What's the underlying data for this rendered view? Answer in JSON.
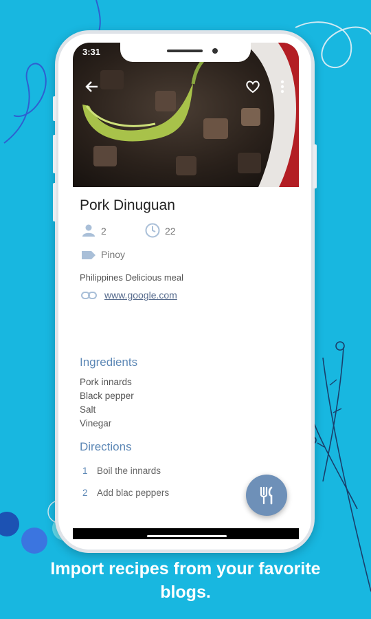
{
  "status_bar": {
    "time": "3:31"
  },
  "recipe": {
    "title": "Pork Dinuguan",
    "servings": "2",
    "time": "22",
    "category": "Pinoy",
    "description": "Philippines Delicious meal",
    "link": "www.google.com"
  },
  "ingredients": {
    "heading": "Ingredients",
    "items": [
      "Pork innards",
      "Black pepper",
      "Salt",
      "Vinegar"
    ]
  },
  "directions": {
    "heading": "Directions",
    "steps": [
      {
        "num": "1",
        "text": "Boil the innards"
      },
      {
        "num": "2",
        "text": "Add blac peppers"
      }
    ]
  },
  "icons": {
    "back": "arrow-left-icon",
    "favorite": "heart-outline-icon",
    "more": "more-vert-icon",
    "servings": "person-icon",
    "time": "clock-icon",
    "category": "label-icon",
    "link": "link-icon",
    "fab": "cutlery-icon"
  },
  "colors": {
    "background": "#18b7e0",
    "accent": "#5d88b6",
    "fab": "#6e90b8",
    "text": "#222222"
  },
  "caption": {
    "line1": "Import recipes from your favorite",
    "line2": "blogs."
  }
}
